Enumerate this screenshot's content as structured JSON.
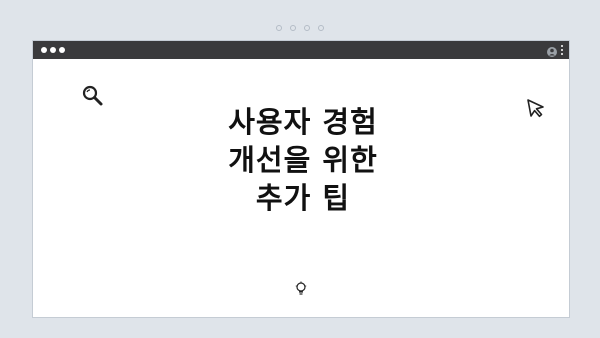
{
  "heading": {
    "line1": "사용자 경험",
    "line2": "개선을 위한",
    "line3": "추가 팁"
  },
  "icons": {
    "top_dots": "decorative-dots",
    "window_controls": "traffic-light-dots",
    "user": "user-icon",
    "menu": "kebab-menu-icon",
    "search": "search-icon",
    "cursor": "cursor-arrow-icon",
    "bulb": "lightbulb-icon"
  },
  "colors": {
    "background": "#dfe4ea",
    "titlebar": "#3a3a3c",
    "window": "#ffffff",
    "text": "#111111"
  }
}
